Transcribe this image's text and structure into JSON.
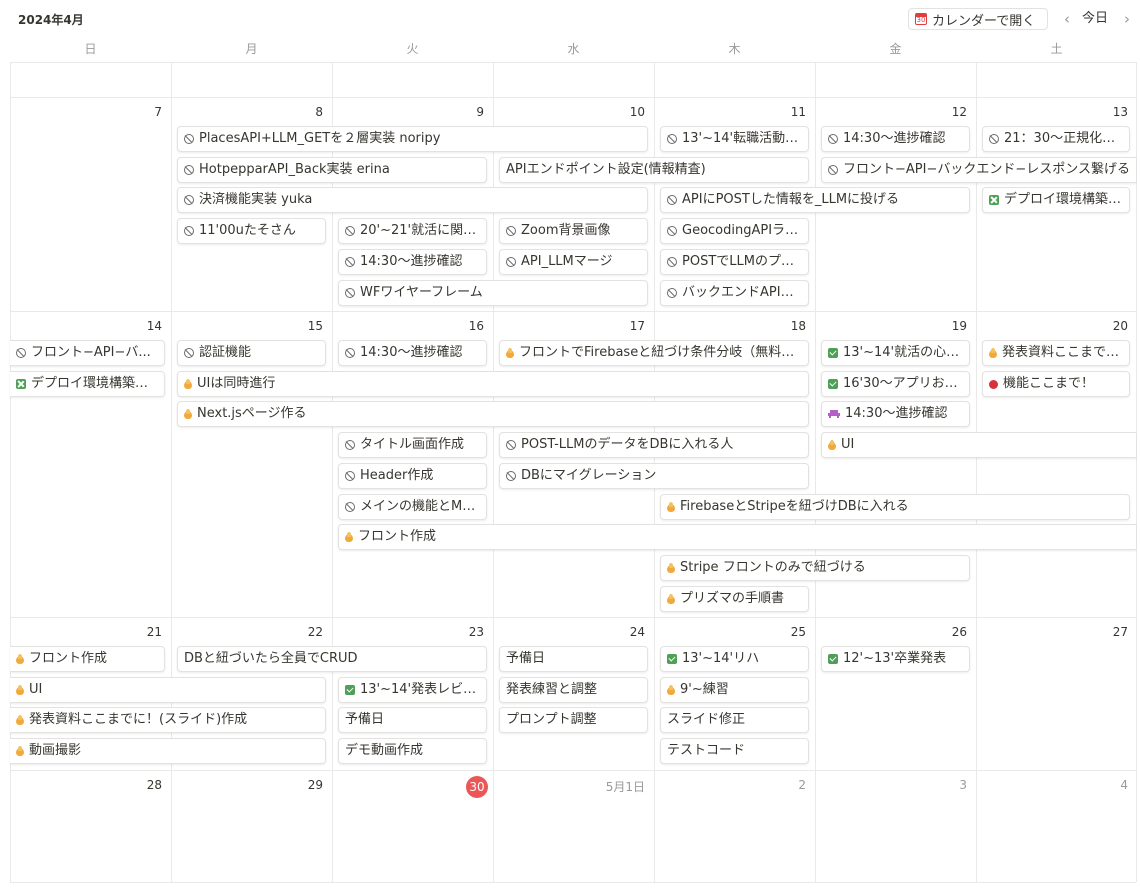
{
  "header": {
    "month_title": "2024年4月",
    "open_calendar_label": "カレンダーで開く",
    "calendar_icon_text": "30",
    "today_label": "今日",
    "prev_glyph": "‹",
    "next_glyph": "›"
  },
  "weekdays": [
    "日",
    "月",
    "火",
    "水",
    "木",
    "金",
    "土"
  ],
  "weeks": [
    {
      "days": [
        "",
        "",
        "",
        "",
        "",
        "",
        ""
      ]
    },
    {
      "days": [
        "7",
        "8",
        "9",
        "10",
        "11",
        "12",
        "13"
      ]
    },
    {
      "days": [
        "14",
        "15",
        "16",
        "17",
        "18",
        "19",
        "20"
      ]
    },
    {
      "days": [
        "21",
        "22",
        "23",
        "24",
        "25",
        "26",
        "27"
      ]
    },
    {
      "days": [
        "28",
        "29",
        "30",
        "5月1日",
        "2",
        "3",
        "4"
      ]
    }
  ],
  "today_day": "30",
  "events": [
    {
      "week": 1,
      "col": 1,
      "span": 3,
      "row": 0,
      "icon": "block",
      "title": "PlacesAPI+LLM_GETを２層実装 noripy"
    },
    {
      "week": 1,
      "col": 1,
      "span": 2,
      "row": 1,
      "icon": "block",
      "title": "HotpepparAPI_Back実装 erina"
    },
    {
      "week": 1,
      "col": 1,
      "span": 3,
      "row": 2,
      "icon": "block",
      "title": "決済機能実装 yuka"
    },
    {
      "week": 1,
      "col": 1,
      "span": 1,
      "row": 3,
      "icon": "block",
      "title": "11'00uたそさん"
    },
    {
      "week": 1,
      "col": 2,
      "span": 1,
      "row": 3,
      "icon": "block",
      "title": "20'~21'就活に関する..."
    },
    {
      "week": 1,
      "col": 2,
      "span": 1,
      "row": 4,
      "icon": "block",
      "title": "14:30〜進捗確認"
    },
    {
      "week": 1,
      "col": 2,
      "span": 2,
      "row": 5,
      "icon": "block",
      "title": "WFワイヤーフレーム"
    },
    {
      "week": 1,
      "col": 3,
      "span": 2,
      "row": 1,
      "icon": "none",
      "title": "APIエンドポイント設定(情報精査)"
    },
    {
      "week": 1,
      "col": 3,
      "span": 1,
      "row": 3,
      "icon": "block",
      "title": "Zoom背景画像"
    },
    {
      "week": 1,
      "col": 3,
      "span": 1,
      "row": 4,
      "icon": "block",
      "title": "API_LLMマージ"
    },
    {
      "week": 1,
      "col": 4,
      "span": 1,
      "row": 0,
      "icon": "block",
      "title": "13'~14'転職活動に..."
    },
    {
      "week": 1,
      "col": 4,
      "span": 2,
      "row": 2,
      "icon": "block",
      "title": "APIにPOSTした情報を_LLMに投げる"
    },
    {
      "week": 1,
      "col": 4,
      "span": 1,
      "row": 3,
      "icon": "block",
      "title": "GeocodingAPIラン..."
    },
    {
      "week": 1,
      "col": 4,
      "span": 1,
      "row": 4,
      "icon": "block",
      "title": "POSTでLLMのプロ..."
    },
    {
      "week": 1,
      "col": 4,
      "span": 1,
      "row": 5,
      "icon": "block",
      "title": "バックエンドAPI同..."
    },
    {
      "week": 1,
      "col": 5,
      "span": 1,
      "row": 0,
      "icon": "block",
      "title": "14:30〜進捗確認"
    },
    {
      "week": 1,
      "col": 5,
      "span": 2,
      "row": 1,
      "icon": "block",
      "title": "フロント−API−バックエンド−レスポンス繋げる",
      "open_right": true
    },
    {
      "week": 1,
      "col": 6,
      "span": 1,
      "row": 0,
      "icon": "block",
      "title": "21：30〜正規化・E..."
    },
    {
      "week": 1,
      "col": 6,
      "span": 1,
      "row": 2,
      "icon": "cross",
      "title": "デプロイ環境構築イ..."
    },
    {
      "week": 2,
      "col": 0,
      "span": 1,
      "row": 0,
      "icon": "block",
      "title": "フロント−API−バ...",
      "open_left": true
    },
    {
      "week": 2,
      "col": 0,
      "span": 1,
      "row": 1,
      "icon": "cross",
      "title": "デプロイ環境構築イ...",
      "open_left": true
    },
    {
      "week": 2,
      "col": 1,
      "span": 1,
      "row": 0,
      "icon": "block",
      "title": "認証機能"
    },
    {
      "week": 2,
      "col": 1,
      "span": 4,
      "row": 1,
      "icon": "fire",
      "title": "UIは同時進行"
    },
    {
      "week": 2,
      "col": 1,
      "span": 4,
      "row": 2,
      "icon": "fire",
      "title": "Next.jsページ作る"
    },
    {
      "week": 2,
      "col": 2,
      "span": 1,
      "row": 0,
      "icon": "block",
      "title": "14:30〜進捗確認"
    },
    {
      "week": 2,
      "col": 2,
      "span": 1,
      "row": 3,
      "icon": "block",
      "title": "タイトル画面作成"
    },
    {
      "week": 2,
      "col": 2,
      "span": 1,
      "row": 4,
      "icon": "block",
      "title": "Header作成"
    },
    {
      "week": 2,
      "col": 2,
      "span": 1,
      "row": 5,
      "icon": "block",
      "title": "メインの機能とMa..."
    },
    {
      "week": 2,
      "col": 2,
      "span": 5,
      "row": 6,
      "icon": "fire",
      "title": "フロント作成",
      "open_right": true
    },
    {
      "week": 2,
      "col": 3,
      "span": 2,
      "row": 0,
      "icon": "fire",
      "title": "フロントでFirebaseと紐づけ条件分岐（無料ユー..."
    },
    {
      "week": 2,
      "col": 3,
      "span": 2,
      "row": 3,
      "icon": "block",
      "title": "POST-LLMのデータをDBに入れる人"
    },
    {
      "week": 2,
      "col": 3,
      "span": 2,
      "row": 4,
      "icon": "block",
      "title": "DBにマイグレーション"
    },
    {
      "week": 2,
      "col": 4,
      "span": 3,
      "row": 5,
      "icon": "fire",
      "title": "FirebaseとStripeを紐づけDBに入れる"
    },
    {
      "week": 2,
      "col": 4,
      "span": 2,
      "row": 7,
      "icon": "fire",
      "title": "Stripe フロントのみで紐づける"
    },
    {
      "week": 2,
      "col": 4,
      "span": 1,
      "row": 8,
      "icon": "fire",
      "title": "プリズマの手順書"
    },
    {
      "week": 2,
      "col": 5,
      "span": 1,
      "row": 0,
      "icon": "check",
      "title": "13'~14'就活の心得..."
    },
    {
      "week": 2,
      "col": 5,
      "span": 1,
      "row": 1,
      "icon": "check",
      "title": "16'30〜アプリお披..."
    },
    {
      "week": 2,
      "col": 5,
      "span": 1,
      "row": 2,
      "icon": "invader",
      "title": "14:30〜進捗確認"
    },
    {
      "week": 2,
      "col": 5,
      "span": 2,
      "row": 3,
      "icon": "fire",
      "title": "UI",
      "open_right": true
    },
    {
      "week": 2,
      "col": 6,
      "span": 1,
      "row": 0,
      "icon": "fire",
      "title": "発表資料ここまでに..."
    },
    {
      "week": 2,
      "col": 6,
      "span": 1,
      "row": 1,
      "icon": "dot",
      "title": "機能ここまで！"
    },
    {
      "week": 3,
      "col": 0,
      "span": 1,
      "row": 0,
      "icon": "fire",
      "title": "フロント作成",
      "open_left": true
    },
    {
      "week": 3,
      "col": 0,
      "span": 2,
      "row": 1,
      "icon": "fire",
      "title": "UI",
      "open_left": true
    },
    {
      "week": 3,
      "col": 0,
      "span": 2,
      "row": 2,
      "icon": "fire",
      "title": "発表資料ここまでに！(スライド)作成",
      "open_left": true
    },
    {
      "week": 3,
      "col": 0,
      "span": 2,
      "row": 3,
      "icon": "fire",
      "title": "動画撮影",
      "open_left": true
    },
    {
      "week": 3,
      "col": 1,
      "span": 2,
      "row": 0,
      "icon": "none",
      "title": "DBと紐づいたら全員でCRUD"
    },
    {
      "week": 3,
      "col": 2,
      "span": 1,
      "row": 1,
      "icon": "check",
      "title": "13'~14'発表レビュー"
    },
    {
      "week": 3,
      "col": 2,
      "span": 1,
      "row": 2,
      "icon": "none",
      "title": "予備日"
    },
    {
      "week": 3,
      "col": 2,
      "span": 1,
      "row": 3,
      "icon": "none",
      "title": "デモ動画作成"
    },
    {
      "week": 3,
      "col": 3,
      "span": 1,
      "row": 0,
      "icon": "none",
      "title": "予備日"
    },
    {
      "week": 3,
      "col": 3,
      "span": 1,
      "row": 1,
      "icon": "none",
      "title": "発表練習と調整"
    },
    {
      "week": 3,
      "col": 3,
      "span": 1,
      "row": 2,
      "icon": "none",
      "title": "プロンプト調整"
    },
    {
      "week": 3,
      "col": 4,
      "span": 1,
      "row": 0,
      "icon": "check",
      "title": "13'~14'リハ"
    },
    {
      "week": 3,
      "col": 4,
      "span": 1,
      "row": 1,
      "icon": "fire",
      "title": "9'~練習"
    },
    {
      "week": 3,
      "col": 4,
      "span": 1,
      "row": 2,
      "icon": "none",
      "title": "スライド修正"
    },
    {
      "week": 3,
      "col": 4,
      "span": 1,
      "row": 3,
      "icon": "none",
      "title": "テストコード"
    },
    {
      "week": 3,
      "col": 5,
      "span": 1,
      "row": 0,
      "icon": "check",
      "title": "12'~13'卒業発表"
    }
  ]
}
